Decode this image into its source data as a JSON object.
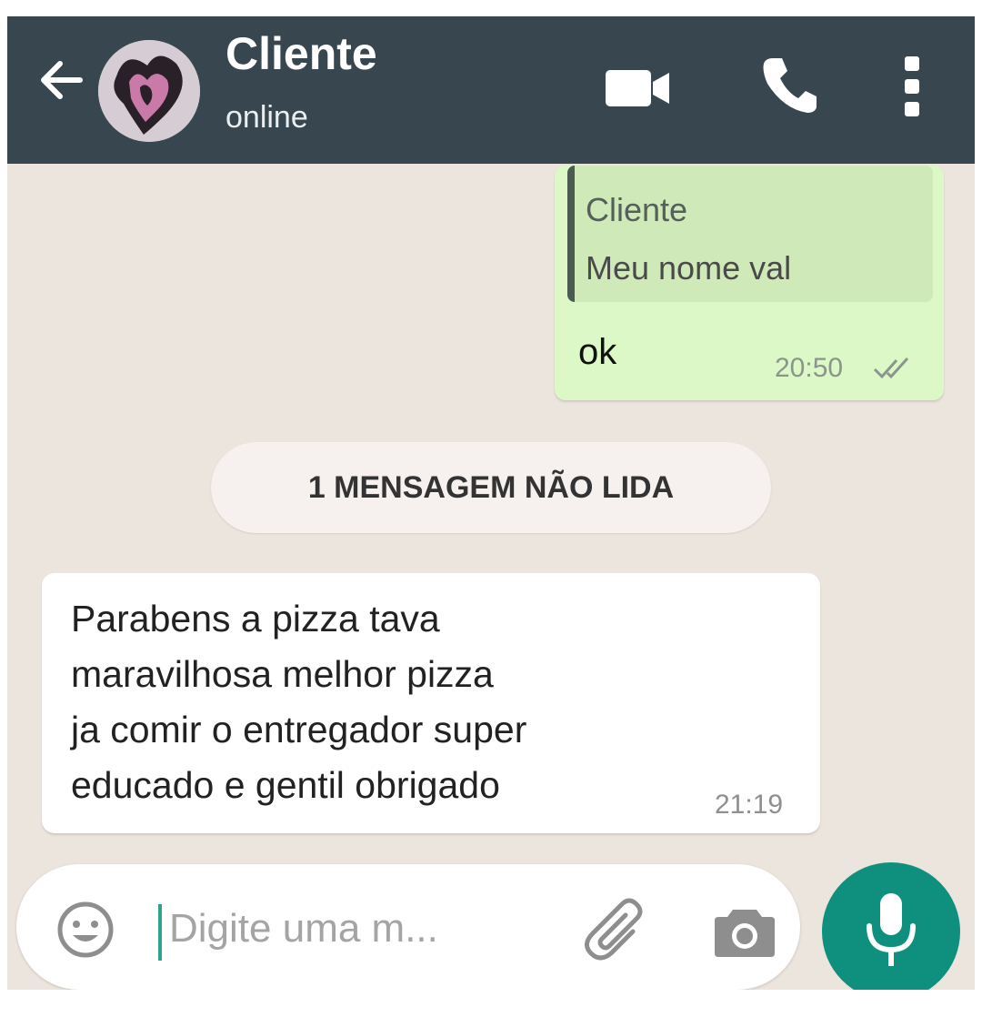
{
  "colors": {
    "header": "#384650",
    "chat_background": "#ece5dd",
    "sent_bubble": "#dcf8c6",
    "received_bubble": "#ffffff",
    "accent": "#0f8f7e"
  },
  "header": {
    "back_icon": "arrow-left-icon",
    "contact_name": "Cliente",
    "status": "online",
    "icons": [
      "video-call-icon",
      "phone-icon",
      "more-vert-icon"
    ]
  },
  "messages": {
    "sent": {
      "quoted_author": "Cliente",
      "quoted_text": "Meu nome val",
      "text": "ok",
      "time": "20:50",
      "status_icon": "double-check-icon"
    },
    "unread_banner": "1 MENSAGEM NÃO LIDA",
    "received": {
      "text": "Parabens a pizza tava\nmaravilhosa melhor pizza\nja comir o entregador super\neducado e gentil  obrigado",
      "time": "21:19"
    }
  },
  "composer": {
    "placeholder": "Digite uma m...",
    "icons": [
      "emoji-icon",
      "attach-icon",
      "camera-icon",
      "mic-icon"
    ]
  }
}
